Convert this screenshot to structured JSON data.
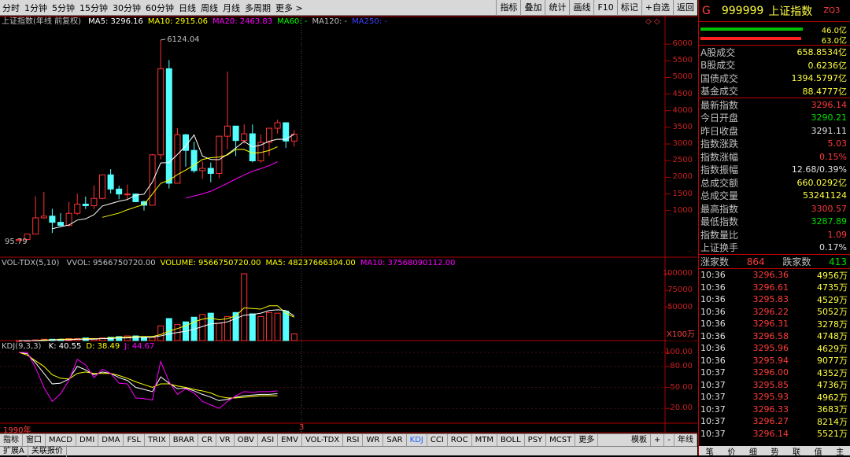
{
  "toolbar": {
    "periods": [
      "分时",
      "1分钟",
      "5分钟",
      "15分钟",
      "30分钟",
      "60分钟",
      "日线",
      "周线",
      "月线",
      "多周期",
      "更多 >"
    ],
    "buttons": [
      "指标",
      "叠加",
      "统计",
      "画线",
      "F10",
      "标记",
      "+自选",
      "返回"
    ]
  },
  "main_chart": {
    "name": "上证指数(年线 前复权)",
    "ma": [
      {
        "label": "MA5: 3296.16",
        "color": "#ffffff"
      },
      {
        "label": "MA10: 2915.06",
        "color": "#ffff00"
      },
      {
        "label": "MA20: 2463.83",
        "color": "#ff00ff"
      },
      {
        "label": "MA60: -",
        "color": "#00ff00"
      },
      {
        "label": "MA120: -",
        "color": "#c0c0c0"
      },
      {
        "label": "MA250: -",
        "color": "#4040ff"
      }
    ],
    "high_label": "6124.04",
    "low_label": "95.79"
  },
  "vol_chart": {
    "name": "VOL-TDX(5,10)",
    "items": [
      {
        "label": "VVOL: 9566750720.00",
        "color": "#c0c0c0"
      },
      {
        "label": "VOLUME: 9566750720.00",
        "color": "#ffff00"
      },
      {
        "label": "MA5: 48237666304.00",
        "color": "#ffff00"
      },
      {
        "label": "MA10: 37568090112.00",
        "color": "#ff00ff"
      }
    ],
    "unit": "X100万"
  },
  "kdj_chart": {
    "name": "KDJ(9,3,3)",
    "items": [
      {
        "label": "K: 40.55",
        "color": "#ffffff"
      },
      {
        "label": "D: 38.49",
        "color": "#ffff00"
      },
      {
        "label": "J: 44.67",
        "color": "#ff00ff"
      }
    ]
  },
  "axis": {
    "price": [
      "6000",
      "5500",
      "5000",
      "4500",
      "4000",
      "3500",
      "3000",
      "2500",
      "2000",
      "1500",
      "1000"
    ],
    "vol": [
      "100000",
      "75000",
      "50000"
    ],
    "kdj": [
      "100.00",
      "80.00",
      "50.00",
      "20.00"
    ]
  },
  "bottom": {
    "start_year": "1990年",
    "end_marker": "3",
    "tabs": [
      "指标",
      "窗口",
      "MACD",
      "DMI",
      "DMA",
      "FSL",
      "TRIX",
      "BRAR",
      "CR",
      "VR",
      "OBV",
      "ASI",
      "EMV",
      "VOL-TDX",
      "RSI",
      "WR",
      "SAR",
      "KDJ",
      "CCI",
      "ROC",
      "MTM",
      "BOLL",
      "PSY",
      "MCST",
      "更多"
    ],
    "right": [
      "模板",
      "+",
      "-"
    ],
    "period": "年线",
    "extra": [
      "扩展A",
      "关联报价"
    ]
  },
  "panel": {
    "code": "999999",
    "name": "上证指数",
    "tag": "ZQ3",
    "g": "G",
    "bar1": "46.0亿",
    "bar2": "63.0亿",
    "turnover": [
      {
        "k": "A股成交",
        "v": "658.8534亿",
        "c": "#ffff40"
      },
      {
        "k": "B股成交",
        "v": "0.6236亿",
        "c": "#ffff40"
      },
      {
        "k": "国债成交",
        "v": "1394.5797亿",
        "c": "#ffff40"
      },
      {
        "k": "基金成交",
        "v": "88.4777亿",
        "c": "#ffff40"
      }
    ],
    "stats": [
      {
        "k": "最新指数",
        "v": "3296.14",
        "c": "#ff3b3b"
      },
      {
        "k": "今日开盘",
        "v": "3290.21",
        "c": "#00e000"
      },
      {
        "k": "昨日收盘",
        "v": "3291.11",
        "c": "#e0e0e0"
      },
      {
        "k": "指数涨跌",
        "v": "5.03",
        "c": "#ff3b3b"
      },
      {
        "k": "指数涨幅",
        "v": "0.15%",
        "c": "#ff3b3b"
      },
      {
        "k": "指数振幅",
        "v": "12.68/0.39%",
        "c": "#e0e0e0"
      },
      {
        "k": "总成交额",
        "v": "660.0292亿",
        "c": "#ffff40"
      },
      {
        "k": "总成交量",
        "v": "53241124",
        "c": "#ffff40"
      },
      {
        "k": "最高指数",
        "v": "3300.57",
        "c": "#ff3b3b"
      },
      {
        "k": "最低指数",
        "v": "3287.89",
        "c": "#00e000"
      },
      {
        "k": "指数量比",
        "v": "1.09",
        "c": "#ff3b3b"
      },
      {
        "k": "上证换手",
        "v": "0.17%",
        "c": "#e0e0e0"
      }
    ],
    "updown": {
      "up_label": "涨家数",
      "up": "864",
      "down_label": "跌家数",
      "down": "413"
    },
    "ticks": [
      {
        "t": "10:36",
        "p": "3296.36",
        "v": "4956万"
      },
      {
        "t": "10:36",
        "p": "3296.61",
        "v": "4735万"
      },
      {
        "t": "10:36",
        "p": "3295.83",
        "v": "4529万"
      },
      {
        "t": "10:36",
        "p": "3296.22",
        "v": "5052万"
      },
      {
        "t": "10:36",
        "p": "3296.31",
        "v": "3278万"
      },
      {
        "t": "10:36",
        "p": "3296.58",
        "v": "4748万"
      },
      {
        "t": "10:36",
        "p": "3295.96",
        "v": "4629万"
      },
      {
        "t": "10:36",
        "p": "3295.94",
        "v": "9077万"
      },
      {
        "t": "10:37",
        "p": "3296.00",
        "v": "4352万"
      },
      {
        "t": "10:37",
        "p": "3295.85",
        "v": "4736万"
      },
      {
        "t": "10:37",
        "p": "3295.93",
        "v": "4962万"
      },
      {
        "t": "10:37",
        "p": "3296.33",
        "v": "3683万"
      },
      {
        "t": "10:37",
        "p": "3296.27",
        "v": "8214万"
      },
      {
        "t": "10:37",
        "p": "3296.14",
        "v": "5521万"
      }
    ],
    "tabs": [
      "笔",
      "价",
      "细",
      "势",
      "联",
      "值",
      "主"
    ]
  },
  "chart_data": {
    "type": "candlestick",
    "candles": [
      {
        "o": 96,
        "h": 128,
        "l": 96,
        "c": 128
      },
      {
        "o": 128,
        "h": 292,
        "l": 104,
        "c": 292
      },
      {
        "o": 292,
        "h": 1429,
        "l": 292,
        "c": 780
      },
      {
        "o": 780,
        "h": 1558,
        "l": 750,
        "c": 833
      },
      {
        "o": 833,
        "h": 1053,
        "l": 325,
        "c": 647
      },
      {
        "o": 647,
        "h": 926,
        "l": 512,
        "c": 555
      },
      {
        "o": 555,
        "h": 1258,
        "l": 512,
        "c": 917
      },
      {
        "o": 917,
        "h": 1510,
        "l": 870,
        "c": 1194
      },
      {
        "o": 1194,
        "h": 1422,
        "l": 1047,
        "c": 1146
      },
      {
        "o": 1146,
        "h": 1756,
        "l": 1047,
        "c": 1366
      },
      {
        "o": 1366,
        "h": 2073,
        "l": 1341,
        "c": 2073
      },
      {
        "o": 2073,
        "h": 2245,
        "l": 1514,
        "c": 1646
      },
      {
        "o": 1646,
        "h": 1748,
        "l": 1339,
        "c": 1497
      },
      {
        "o": 1497,
        "h": 1783,
        "l": 1307,
        "c": 1497
      },
      {
        "o": 1497,
        "h": 1512,
        "l": 1259,
        "c": 1267
      },
      {
        "o": 1267,
        "h": 1301,
        "l": 998,
        "c": 1161
      },
      {
        "o": 1161,
        "h": 2698,
        "l": 1161,
        "c": 2675
      },
      {
        "o": 2675,
        "h": 6124,
        "l": 2541,
        "c": 5262
      },
      {
        "o": 5262,
        "h": 5522,
        "l": 1664,
        "c": 1821
      },
      {
        "o": 1821,
        "h": 3478,
        "l": 1849,
        "c": 3277
      },
      {
        "o": 3277,
        "h": 3306,
        "l": 2319,
        "c": 2808
      },
      {
        "o": 2808,
        "h": 3067,
        "l": 2134,
        "c": 2199
      },
      {
        "o": 2199,
        "h": 2478,
        "l": 1949,
        "c": 2269
      },
      {
        "o": 2269,
        "h": 2444,
        "l": 1849,
        "c": 2116
      },
      {
        "o": 2116,
        "h": 3239,
        "l": 1974,
        "c": 3235
      },
      {
        "o": 3235,
        "h": 5178,
        "l": 2850,
        "c": 3539
      },
      {
        "o": 3539,
        "h": 3301,
        "l": 2638,
        "c": 3104
      },
      {
        "o": 3104,
        "h": 3587,
        "l": 3016,
        "c": 3307
      },
      {
        "o": 3307,
        "h": 3587,
        "l": 2449,
        "c": 2494
      },
      {
        "o": 2494,
        "h": 3288,
        "l": 2440,
        "c": 3050
      },
      {
        "o": 3050,
        "h": 3474,
        "l": 2646,
        "c": 3473
      },
      {
        "o": 3473,
        "h": 3731,
        "l": 3312,
        "c": 3640
      },
      {
        "o": 3640,
        "h": 3424,
        "l": 2885,
        "c": 3089
      },
      {
        "o": 3089,
        "h": 3418,
        "l": 2924,
        "c": 3296
      }
    ],
    "ma5": [
      null,
      null,
      null,
      null,
      456,
      513,
      567,
      714,
      753,
      876,
      1136,
      1209,
      1280,
      1331,
      1460,
      1493,
      1856,
      2431,
      2443,
      2685,
      2943,
      3273,
      2639,
      2534,
      2528,
      2690,
      2880,
      3080,
      2911,
      2970,
      3085,
      3144,
      3142,
      3296
    ],
    "ma10": [
      null,
      null,
      null,
      null,
      null,
      null,
      null,
      null,
      null,
      null,
      796,
      861,
      923,
      1023,
      1106,
      1185,
      1496,
      1820,
      1911,
      2080,
      2218,
      2366,
      2535,
      2589,
      2606,
      2671,
      2837,
      2838,
      2721,
      2744,
      2807,
      2918
    ],
    "ma20": [
      null,
      null,
      null,
      null,
      null,
      null,
      null,
      null,
      null,
      null,
      null,
      null,
      null,
      null,
      null,
      null,
      null,
      null,
      null,
      null,
      1370,
      1440,
      1500,
      1580,
      1700,
      1820,
      1950,
      2070,
      2180,
      2260,
      2350,
      2464
    ],
    "volume": [
      0,
      0,
      1,
      2,
      2,
      2,
      3,
      3,
      4,
      3,
      4,
      5,
      6,
      7,
      7,
      5,
      5,
      22,
      33,
      24,
      28,
      35,
      39,
      41,
      26,
      36,
      42,
      100,
      40,
      36,
      42,
      41,
      44,
      10
    ],
    "vol_ma5": [
      0,
      0,
      0,
      1,
      1,
      2,
      2,
      2,
      3,
      3,
      3,
      4,
      5,
      5,
      6,
      6,
      6,
      9,
      14,
      18,
      22,
      28,
      32,
      34,
      31,
      33,
      37,
      49,
      48,
      47,
      52,
      52,
      41,
      35
    ],
    "vol_ma10": [
      0,
      0,
      0,
      0,
      1,
      1,
      1,
      2,
      2,
      2,
      3,
      3,
      4,
      4,
      5,
      5,
      5,
      7,
      10,
      12,
      14,
      17,
      21,
      25,
      26,
      28,
      33,
      38,
      39,
      41,
      45,
      46,
      45,
      37
    ],
    "k": [
      100,
      98,
      85,
      70,
      55,
      56,
      62,
      80,
      75,
      68,
      72,
      70,
      64,
      60,
      50,
      47,
      44,
      65,
      56,
      48,
      49,
      45,
      40,
      36,
      31,
      33,
      36,
      38,
      39,
      40,
      40,
      41
    ],
    "d": [
      100,
      96,
      88,
      80,
      68,
      63,
      62,
      70,
      72,
      70,
      70,
      70,
      67,
      63,
      58,
      54,
      50,
      55,
      55,
      52,
      50,
      47,
      45,
      42,
      37,
      35,
      35,
      36,
      37,
      38,
      38,
      38
    ],
    "j": [
      100,
      100,
      78,
      50,
      30,
      41,
      60,
      90,
      82,
      64,
      76,
      70,
      56,
      55,
      35,
      34,
      32,
      87,
      58,
      40,
      48,
      42,
      30,
      25,
      20,
      30,
      38,
      44,
      43,
      44,
      44,
      45
    ],
    "price_range": [
      0,
      6500
    ],
    "vol_range": [
      0,
      110000
    ]
  }
}
